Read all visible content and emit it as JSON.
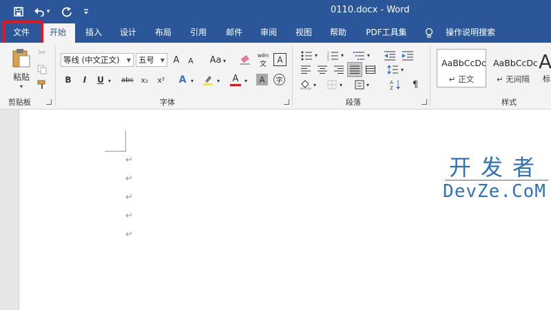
{
  "titlebar": {
    "document_title": "0110.docx  -  Word",
    "quick_access": [
      {
        "name": "save-icon",
        "glyph": "🖫"
      },
      {
        "name": "undo-icon",
        "glyph": "↶"
      },
      {
        "name": "undo-dropdown-icon",
        "glyph": "▾"
      },
      {
        "name": "redo-icon",
        "glyph": "↻"
      },
      {
        "name": "customize-toolbar-icon",
        "glyph": "⩡"
      }
    ]
  },
  "tabs": [
    {
      "label": "文件"
    },
    {
      "label": "开始",
      "active": true
    },
    {
      "label": "插入"
    },
    {
      "label": "设计"
    },
    {
      "label": "布局"
    },
    {
      "label": "引用"
    },
    {
      "label": "邮件"
    },
    {
      "label": "审阅"
    },
    {
      "label": "视图"
    },
    {
      "label": "帮助"
    },
    {
      "label": "PDF工具集"
    }
  ],
  "tell_me": {
    "icon": "lightbulb-icon",
    "label": "操作说明搜索"
  },
  "ribbon": {
    "clipboard": {
      "paste_label": "粘贴",
      "group_label": "剪贴板"
    },
    "font": {
      "font_name": "等线 (中文正文)",
      "font_size": "五号",
      "bold": "B",
      "italic": "I",
      "underline": "U",
      "strikethrough": "abc",
      "subscript": "x₂",
      "superscript": "x²",
      "change_case": "Aa",
      "phonetic_top": "wén",
      "phonetic_bottom": "文",
      "char_border": "A",
      "enclose": "字",
      "shade": "A",
      "font_color": "A",
      "text_effects": "A",
      "grow": "A",
      "shrink": "A",
      "group_label": "字体"
    },
    "paragraph": {
      "group_label": "段落"
    },
    "styles": {
      "group_label": "样式",
      "items": [
        {
          "sample": "AaBbCcDc",
          "name": "↵ 正文"
        },
        {
          "sample": "AaBbCcDc",
          "name": "↵ 无间隔"
        }
      ],
      "next_sample": "A",
      "next_name": "标"
    }
  },
  "document": {
    "paragraph_mark": "↵"
  },
  "watermark": {
    "line1": "开发者",
    "line2": "DevZe.CoM"
  },
  "colors": {
    "accent": "#2b579a",
    "highlight_box": "#e8151a",
    "watermark": "#2e73b8"
  }
}
